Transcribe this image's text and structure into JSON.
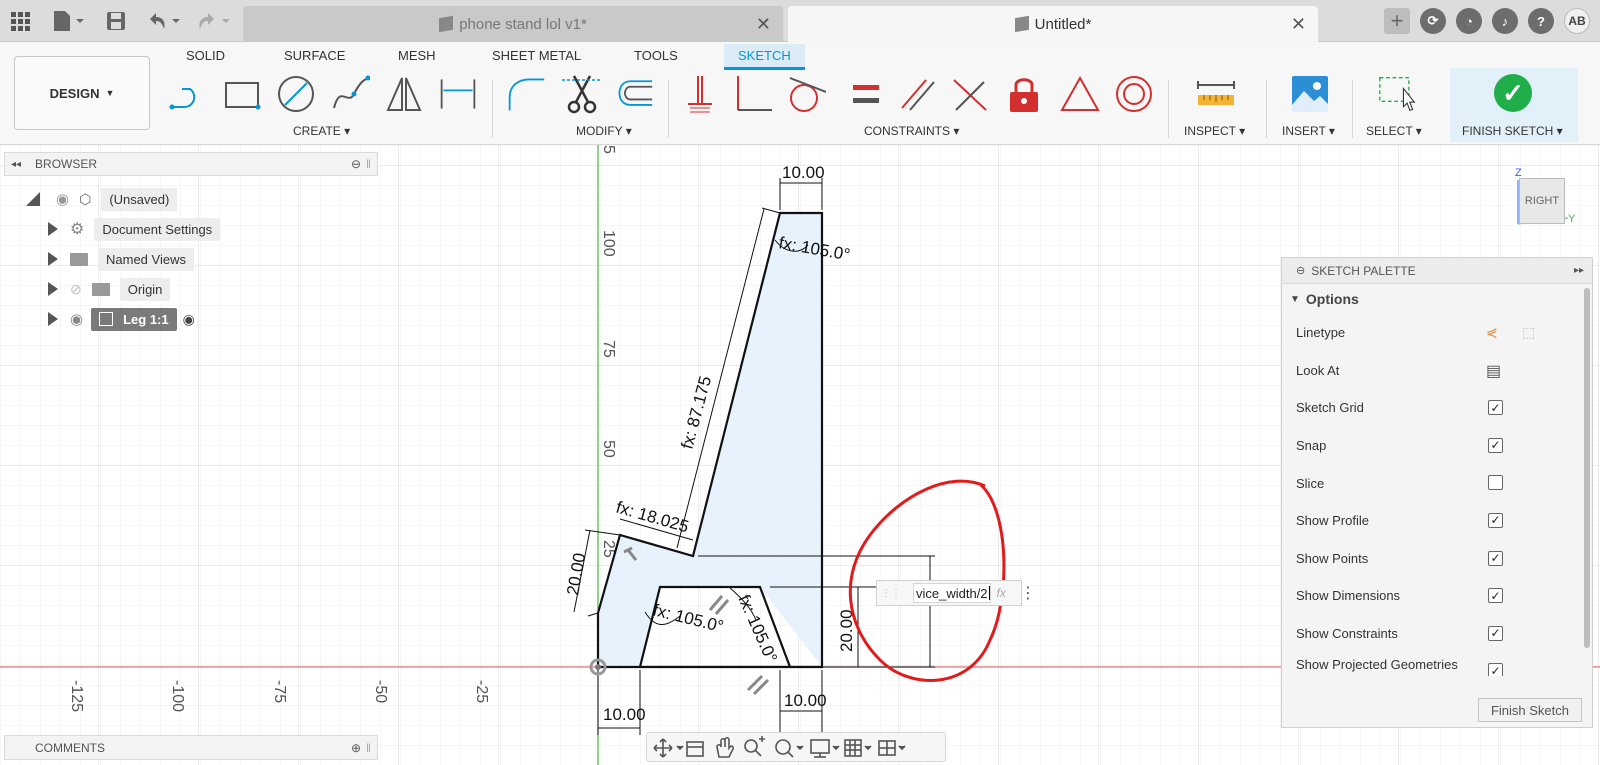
{
  "titlebar": {
    "tabs": [
      {
        "label": "phone stand lol v1*",
        "active": false
      },
      {
        "label": "Untitled*",
        "active": true
      }
    ],
    "avatar_initials": "AB"
  },
  "ribbon": {
    "tabs": [
      "SOLID",
      "SURFACE",
      "MESH",
      "SHEET METAL",
      "TOOLS",
      "SKETCH"
    ],
    "active_tab": "SKETCH",
    "design_label": "DESIGN",
    "groups": {
      "create": "CREATE",
      "modify": "MODIFY",
      "constraints": "CONSTRAINTS",
      "inspect": "INSPECT",
      "insert": "INSERT",
      "select": "SELECT",
      "finish": "FINISH SKETCH"
    },
    "colors": {
      "accent": "#0696d7",
      "finish": "#1fae4a",
      "lock": "#d32f2f"
    }
  },
  "browser": {
    "title": "BROWSER",
    "items": [
      {
        "label": "(Unsaved)"
      },
      {
        "label": "Document Settings"
      },
      {
        "label": "Named Views"
      },
      {
        "label": "Origin"
      },
      {
        "label": "Leg 1:1",
        "selected": true
      }
    ]
  },
  "palette": {
    "title": "SKETCH PALETTE",
    "section": "Options",
    "rows": [
      {
        "label": "Linetype",
        "kind": "icons"
      },
      {
        "label": "Look At",
        "kind": "icon"
      },
      {
        "label": "Sketch Grid",
        "checked": true
      },
      {
        "label": "Snap",
        "checked": true
      },
      {
        "label": "Slice",
        "checked": false
      },
      {
        "label": "Show Profile",
        "checked": true
      },
      {
        "label": "Show Points",
        "checked": true
      },
      {
        "label": "Show Dimensions",
        "checked": true
      },
      {
        "label": "Show Constraints",
        "checked": true
      },
      {
        "label": "Show Projected Geometries",
        "checked": true
      }
    ],
    "finish_button": "Finish Sketch"
  },
  "comments": {
    "title": "COMMENTS"
  },
  "dimension_input": {
    "value": "vice_width/2",
    "fx": "fx"
  },
  "viewcube": {
    "label": "RIGHT",
    "axis_z": "Z",
    "axis_y": "Y"
  },
  "sketch": {
    "dims": {
      "top_width": "10.00",
      "top_angle": "fx: 105.0°",
      "long_edge": "fx: 87.175",
      "short_edge": "fx: 18.025",
      "left_height": "20.00",
      "inner_angle_left": "fx: 105.0°",
      "inner_angle_right": "fx: 105.0°",
      "right_height": "20.00",
      "bottom_left": "10.00",
      "bottom_right": "10.00"
    },
    "axis_labels": {
      "x": [
        "-125",
        "-100",
        "-75",
        "-50",
        "-25"
      ],
      "y": [
        "5",
        "100",
        "75",
        "50",
        "25"
      ]
    }
  }
}
